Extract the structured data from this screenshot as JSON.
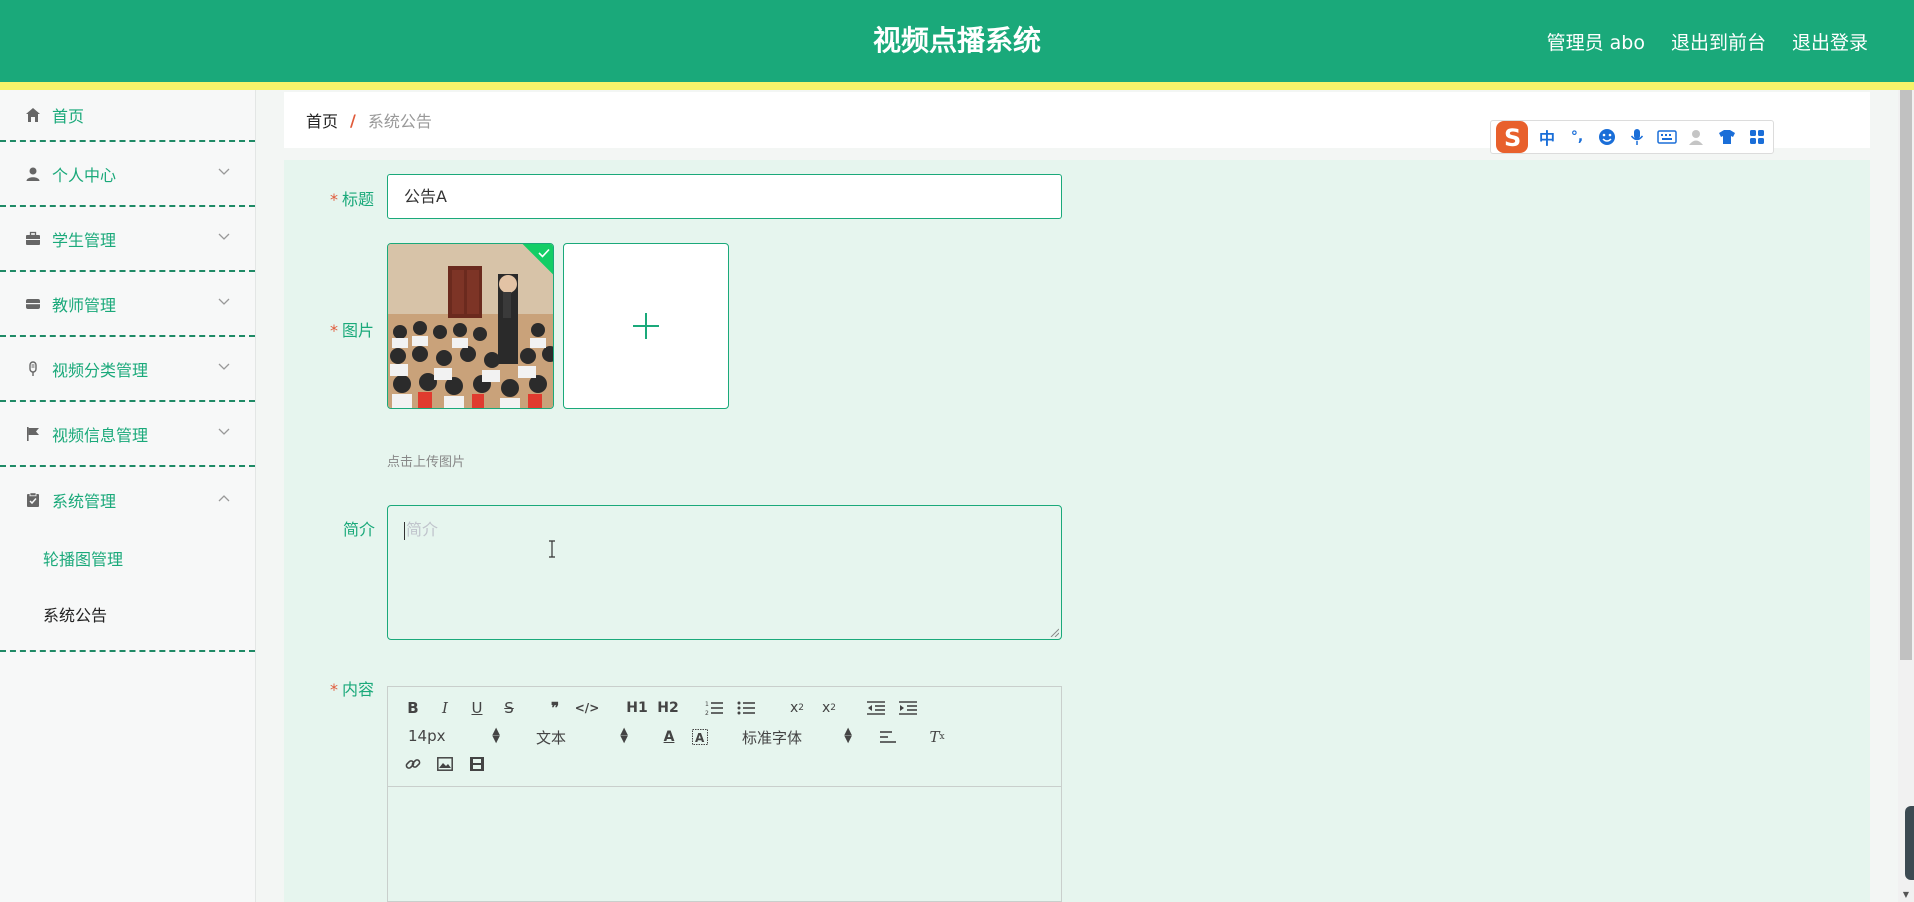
{
  "header": {
    "title": "视频点播系统",
    "user": "管理员 abo",
    "to_frontend": "退出到前台",
    "logout": "退出登录"
  },
  "sidebar": {
    "items": [
      {
        "label": "首页",
        "icon": "home-icon"
      },
      {
        "label": "个人中心",
        "icon": "user-icon"
      },
      {
        "label": "学生管理",
        "icon": "briefcase-icon"
      },
      {
        "label": "教师管理",
        "icon": "inbox-icon"
      },
      {
        "label": "视频分类管理",
        "icon": "microphone-icon"
      },
      {
        "label": "视频信息管理",
        "icon": "flag-icon"
      },
      {
        "label": "系统管理",
        "icon": "clipboard-check-icon"
      }
    ],
    "submenu": [
      "轮播图管理",
      "系统公告"
    ]
  },
  "breadcrumb": {
    "home": "首页",
    "separator": "/",
    "current": "系统公告"
  },
  "form": {
    "title_label": "标题",
    "title_value": "公告A",
    "image_label": "图片",
    "upload_hint": "点击上传图片",
    "intro_label": "简介",
    "intro_placeholder": "简介",
    "content_label": "内容",
    "required_mark": "*"
  },
  "editor": {
    "font_size": "14px",
    "header_select": "文本",
    "font_family": "标准字体",
    "h1": "H1",
    "h2": "H2"
  },
  "ime": {
    "lang": "中",
    "punct": "°,"
  },
  "colors": {
    "primary": "#1aa97a",
    "stripe": "#f6f36a",
    "panel": "#e6f5ee",
    "required": "#e05a3a"
  }
}
